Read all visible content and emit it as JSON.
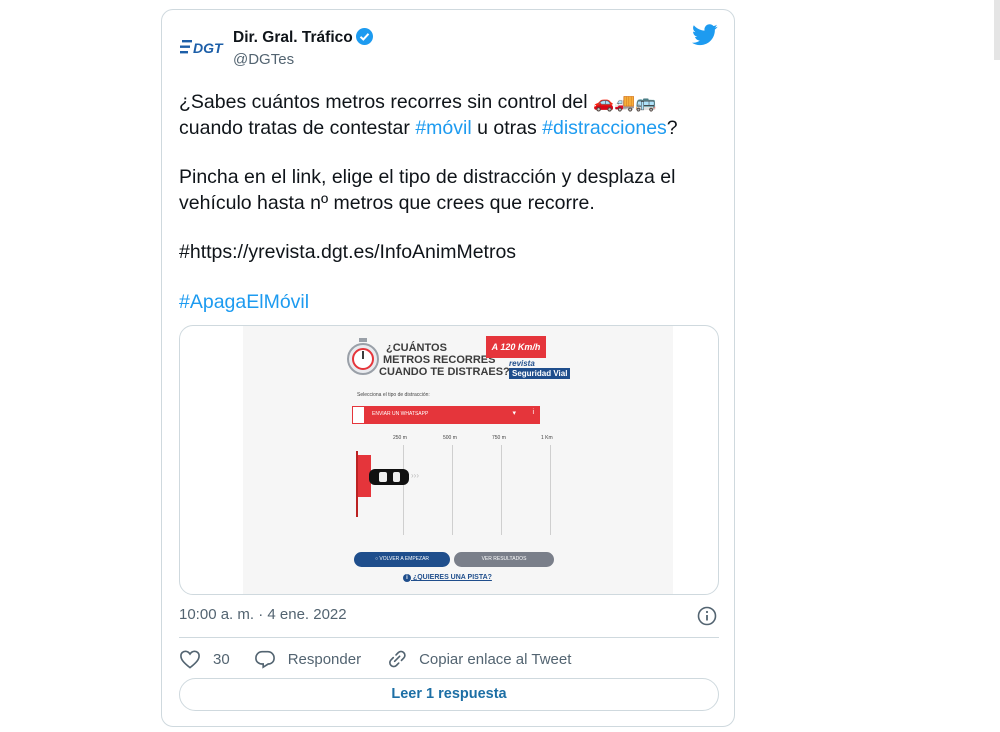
{
  "author": {
    "logo_text": "DGT",
    "name": "Dir. Gral. Tráfico",
    "handle": "@DGTes"
  },
  "tweet": {
    "line1_text": "¿Sabes cuántos metros recorres sin control del",
    "line1_emoji": "🚗🚚🚌",
    "line2_pre": "cuando tratas de contestar ",
    "line2_tag1": "#móvil",
    "line2_mid": " u otras ",
    "line2_tag2": "#distracciones",
    "line2_post": "?",
    "line3": "Pincha en el link, elige el tipo de distracción y desplaza el",
    "line4": "vehículo hasta nº metros que crees que recorre.",
    "line5": "#https://yrevista.dgt.es/InfoAnimMetros",
    "line6_tag": "#ApagaElMóvil"
  },
  "media": {
    "title_line1": "¿CUÁNTOS",
    "title_line2": "METROS RECORRES",
    "title_line3": "CUANDO TE DISTRAES?",
    "speed_badge": "A 120 Km/h",
    "brand_line1": "revista",
    "brand_line2": "Seguridad Vial",
    "select_label": "Selecciona el tipo de distracción:",
    "select_value": "ENVIAR UN WHATSAPP",
    "ticks": [
      "250 m",
      "500 m",
      "750 m",
      "1 Km"
    ],
    "restart_button": "VOLVER A EMPEZAR",
    "results_button": "VER RESULTADOS",
    "hint_link": "¿QUIERES UNA PISTA?"
  },
  "meta": {
    "timestamp": "10:00 a. m. · 4 ene. 2022"
  },
  "actions": {
    "likes": "30",
    "reply_label": "Responder",
    "copy_label": "Copiar enlace al Tweet"
  },
  "read_replies_button": "Leer 1 respuesta",
  "colors": {
    "accent": "#1d9bf0",
    "badge_red": "#e5353b",
    "button_blue": "#1f4e8c",
    "button_gray": "#7a7f8a"
  }
}
